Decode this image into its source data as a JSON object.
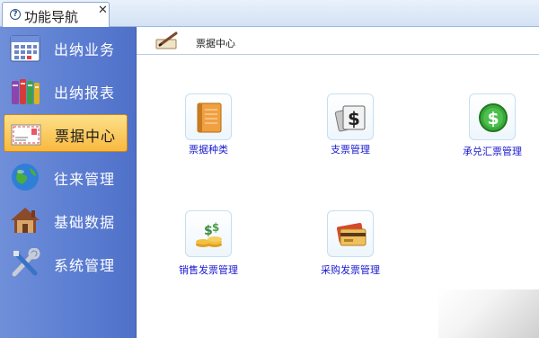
{
  "tab": {
    "icon": "help-icon",
    "title": "功能导航",
    "close": "✕"
  },
  "sidebar": {
    "items": [
      {
        "label": "出纳业务",
        "icon": "calendar-icon"
      },
      {
        "label": "出纳报表",
        "icon": "books-icon"
      },
      {
        "label": "票据中心",
        "icon": "envelope-icon",
        "active": true
      },
      {
        "label": "往来管理",
        "icon": "globe-icon"
      },
      {
        "label": "基础数据",
        "icon": "house-icon"
      },
      {
        "label": "系统管理",
        "icon": "tools-icon"
      }
    ]
  },
  "main": {
    "header": {
      "icon": "pen-icon",
      "title": "票据中心"
    },
    "functions": [
      {
        "label": "票据种类",
        "icon": "notebook-icon"
      },
      {
        "label": "支票管理",
        "icon": "dollar-cards-icon"
      },
      {
        "label": "承兑汇票管理",
        "icon": "dollar-coin-icon"
      },
      {
        "label": "销售发票管理",
        "icon": "coins-icon"
      },
      {
        "label": "采购发票管理",
        "icon": "credit-card-icon"
      }
    ]
  },
  "colors": {
    "sidebar": "#5b7dd1",
    "active": "#f8b93f",
    "link": "#1a1acf"
  }
}
